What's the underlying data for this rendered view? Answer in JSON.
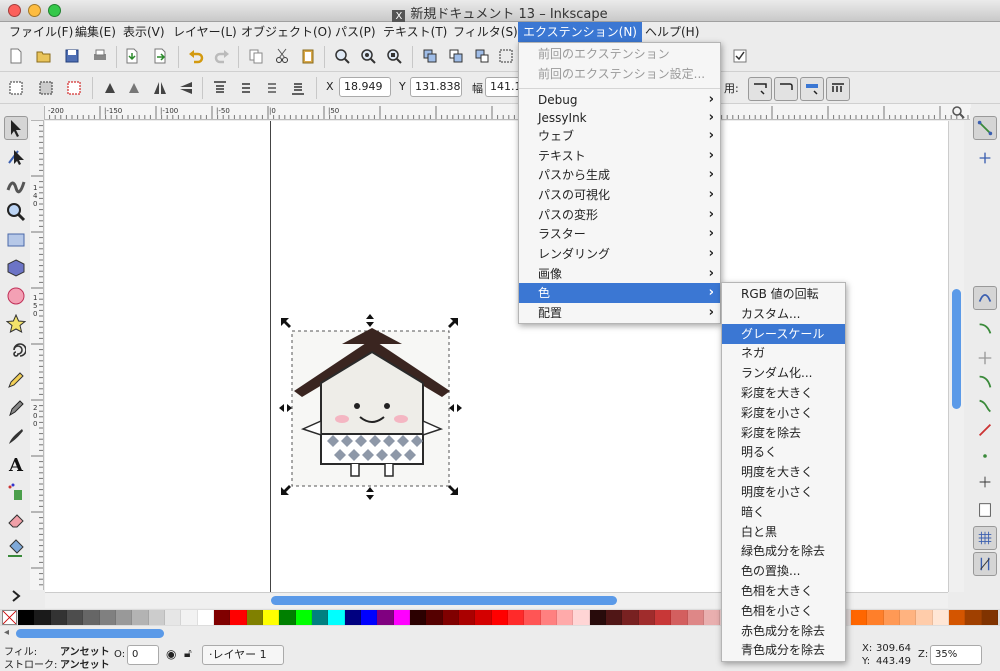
{
  "window": {
    "title": "新規ドキュメント 13 – Inkscape",
    "doc_icon": "X"
  },
  "menubar": [
    "ファイル(F)",
    "編集(E)",
    "表示(V)",
    "レイヤー(L)",
    "オブジェクト(O)",
    "パス(P)",
    "テキスト(T)",
    "フィルタ(S)",
    "エクステンション(N)",
    "ヘルプ(H)"
  ],
  "controls": {
    "x_label": "X",
    "x_value": "18.949",
    "y_label": "Y",
    "y_value": "131.838",
    "w_label": "幅",
    "w_value": "141.11",
    "cut_text": "用:"
  },
  "ruler": {
    "labels": [
      "-200",
      "|-150",
      "|-100",
      "|-50",
      "|0",
      "|50"
    ],
    "vlabels": [
      "1",
      "4",
      "0",
      "1",
      "5",
      "0",
      "2",
      "0",
      "0"
    ]
  },
  "extensions_menu": {
    "recent": [
      "前回のエクステンション",
      "前回のエクステンション設定..."
    ],
    "items": [
      "Debug",
      "JessyInk",
      "ウェブ",
      "テキスト",
      "パスから生成",
      "パスの可視化",
      "パスの変形",
      "ラスター",
      "レンダリング",
      "画像",
      "色",
      "配置"
    ]
  },
  "color_submenu": {
    "items": [
      "RGB 値の回転",
      "カスタム...",
      "グレースケール",
      "ネガ",
      "ランダム化...",
      "彩度を大きく",
      "彩度を小さく",
      "彩度を除去",
      "明るく",
      "明度を大きく",
      "明度を小さく",
      "暗く",
      "白と黒",
      "緑色成分を除去",
      "色の置換...",
      "色相を大きく",
      "色相を小さく",
      "赤色成分を除去",
      "青色成分を除去"
    ],
    "highlighted": "グレースケール"
  },
  "status": {
    "fill_label": "フィル:",
    "fill_value": "アンセット",
    "stroke_label": "ストローク:",
    "stroke_value": "アンセット",
    "opacity_label": "O:",
    "opacity_value": "0",
    "layer": "·レイヤー 1",
    "x_label": "X:",
    "x": "309.64",
    "y_label": "Y:",
    "y": "443.49",
    "zoom_label": "Z:",
    "zoom": "35%"
  },
  "colors": {
    "highlight": "#3b77d3",
    "scroll": "#5b9ae8"
  },
  "palette": [
    "#000000",
    "#1a1a1a",
    "#333333",
    "#4d4d4d",
    "#666666",
    "#808080",
    "#999999",
    "#b3b3b3",
    "#cccccc",
    "#e6e6e6",
    "#f2f2f2",
    "#ffffff",
    "#800000",
    "#ff0000",
    "#808000",
    "#ffff00",
    "#008000",
    "#00ff00",
    "#008080",
    "#00ffff",
    "#000080",
    "#0000ff",
    "#800080",
    "#ff00ff",
    "#2b0000",
    "#550000",
    "#800000",
    "#aa0000",
    "#d40000",
    "#ff0000",
    "#ff2a2a",
    "#ff5555",
    "#ff8080",
    "#ffaaaa",
    "#ffd5d5",
    "#280b0b",
    "#501616",
    "#782121",
    "#a02c2c",
    "#c83737",
    "#d35f5f",
    "#de8787",
    "#e9afaf",
    "#f4d7d7",
    "#241c1c",
    "#483737",
    "#6c5353",
    "#916f6f",
    "#ac9393",
    "#c8b7b7",
    "#e3dbdb",
    "#ff6600",
    "#ff7f2a",
    "#ff9955",
    "#ffb380",
    "#ffccaa",
    "#ffe6d5",
    "#d45500",
    "#a04000",
    "#803300"
  ]
}
